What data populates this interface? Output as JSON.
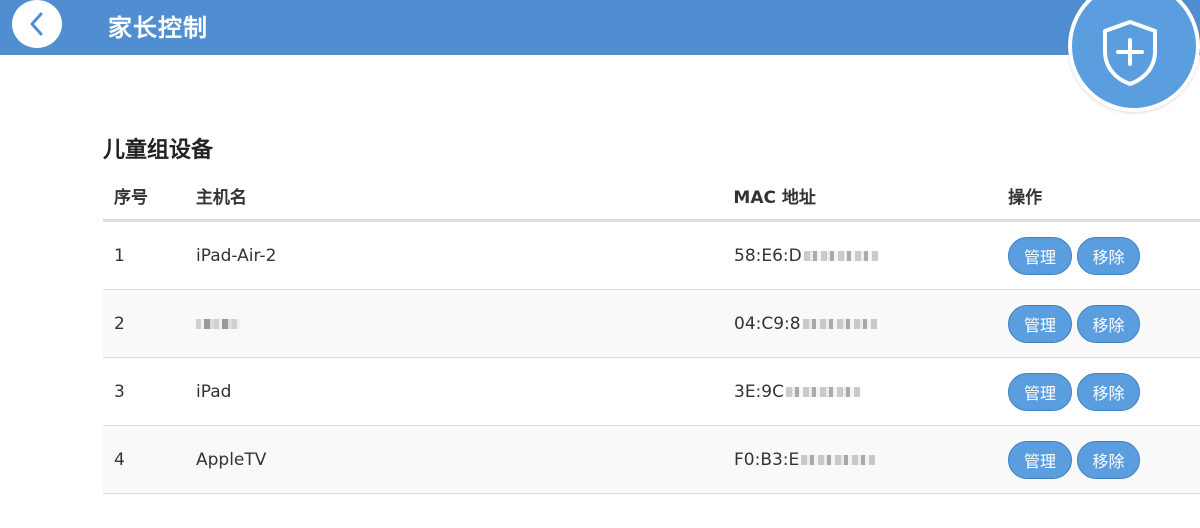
{
  "header": {
    "title": "家长控制",
    "back_icon": "chevron-left-icon",
    "add_icon": "shield-plus-icon",
    "bar_color": "#4f8fd1",
    "accent_color": "#5b9ee0"
  },
  "section": {
    "title": "儿童组设备"
  },
  "table": {
    "columns": {
      "index": "序号",
      "host": "主机名",
      "mac": "MAC 地址",
      "actions": "操作"
    },
    "rows": [
      {
        "index": "1",
        "host": "iPad-Air-2",
        "host_redacted": false,
        "mac": "58:E6:D"
      },
      {
        "index": "2",
        "host": "",
        "host_redacted": true,
        "mac": "04:C9:8"
      },
      {
        "index": "3",
        "host": "iPad",
        "host_redacted": false,
        "mac": "3E:9C"
      },
      {
        "index": "4",
        "host": "AppleTV",
        "host_redacted": false,
        "mac": "F0:B3:E"
      }
    ],
    "manage_label": "管理",
    "remove_label": "移除"
  }
}
